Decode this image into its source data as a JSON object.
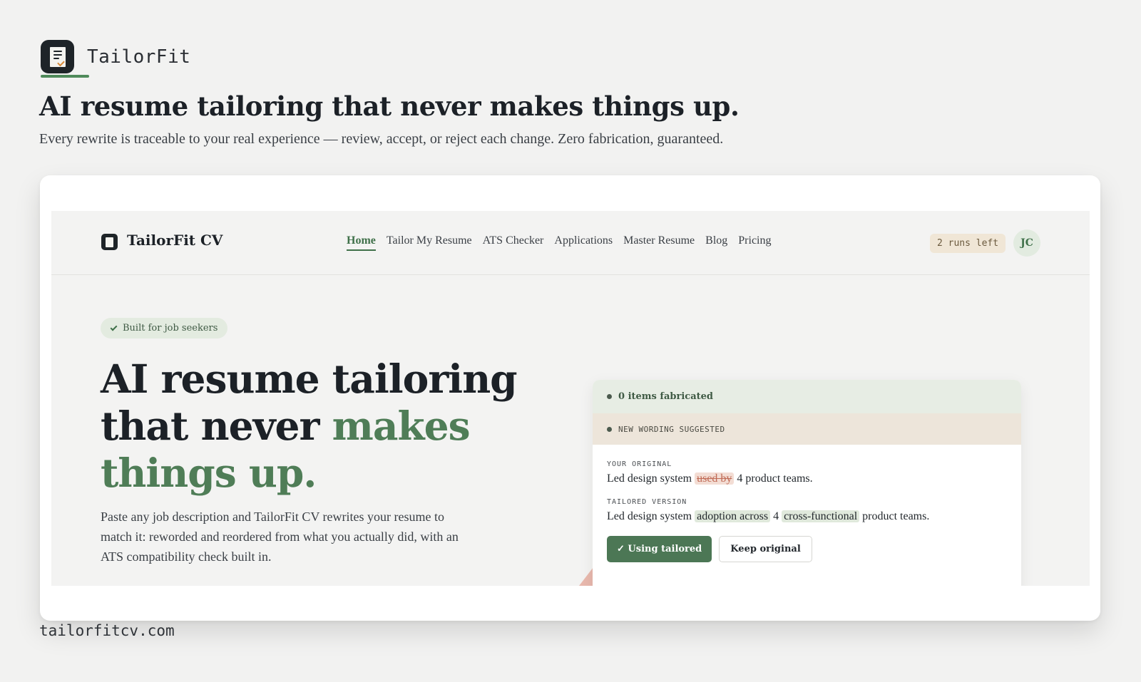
{
  "brand": {
    "name": "TailorFit",
    "icon": "document-check-icon"
  },
  "headline": "AI resume tailoring that never makes things up.",
  "subline": "Every rewrite is traceable to your real experience — review, accept, or reject each change. Zero fabrication, guaranteed.",
  "app": {
    "nav": {
      "brand": "TailorFit CV",
      "links": [
        "Home",
        "Tailor My Resume",
        "ATS Checker",
        "Applications",
        "Master Resume",
        "Blog",
        "Pricing"
      ],
      "active": "Home",
      "runs_badge": "2 runs left",
      "avatar_initials": "JC"
    },
    "hero": {
      "badge": "Built for job seekers",
      "title_part1": "AI resume tailoring that never ",
      "title_highlight": "makes things up.",
      "description": "Paste any job description and TailorFit CV rewrites your resume to match it: reworded and reordered from what you actually did, with an ATS compatibility check built in."
    },
    "review": {
      "fabricated_status": "0 items fabricated",
      "suggestion_label": "NEW WORDING SUGGESTED",
      "original_label": "YOUR ORIGINAL",
      "original": {
        "before": "Led design system ",
        "removed": "used by",
        "after": " 4 product teams."
      },
      "tailored_label": "TAILORED VERSION",
      "tailored": {
        "before": "Led design system ",
        "added1": "adoption across",
        "middle": " 4 ",
        "added2": "cross-functional",
        "after": " product teams."
      },
      "primary_button": "✓ Using tailored",
      "secondary_button": "Keep original"
    }
  },
  "footer_url": "tailorfitcv.com",
  "colors": {
    "accent": "#4f7d57",
    "background": "#f2f2f1",
    "badge": "#f0e6d6"
  }
}
